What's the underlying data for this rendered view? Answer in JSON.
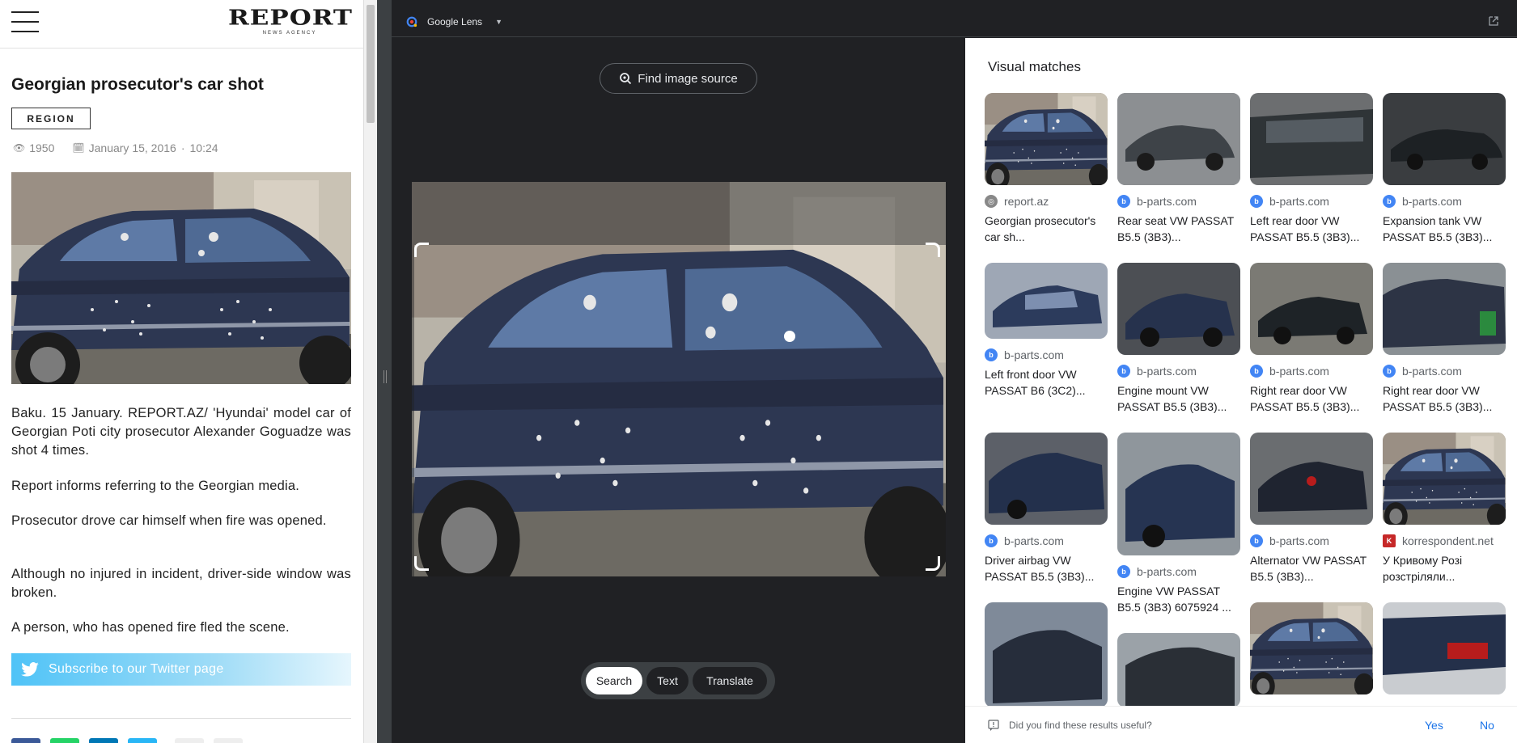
{
  "news": {
    "logo_main": "REPORT",
    "logo_sub": "NEWS AGENCY",
    "title": "Georgian prosecutor's car shot",
    "tag": "REGION",
    "views": "1950",
    "date": "January 15, 2016",
    "time": "10:24",
    "paragraphs": [
      "Baku. 15 January. REPORT.AZ/ 'Hyundai' model car of Georgian Poti city prosecutor Alexander Goguadze was shot 4 times.",
      "Report informs referring to the Georgian media.",
      "Prosecutor drove car himself when fire was opened.",
      "Although no injured in incident, driver-side window was broken.",
      "A person, who has opened fire fled the scene."
    ],
    "twitter_label": "Subscribe to our Twitter page"
  },
  "lens": {
    "title": "Google Lens",
    "find_source": "Find image source",
    "modes": [
      "Search",
      "Text",
      "Translate"
    ]
  },
  "results": {
    "title": "Visual matches",
    "items": [
      {
        "source": "report.az",
        "caption": "Georgian prosecutor's car sh..."
      },
      {
        "source": "b-parts.com",
        "caption": "Rear seat VW PASSAT B5.5 (3B3)..."
      },
      {
        "source": "b-parts.com",
        "caption": "Left rear door VW PASSAT B5.5 (3B3)..."
      },
      {
        "source": "b-parts.com",
        "caption": "Expansion tank VW PASSAT B5.5 (3B3)..."
      },
      {
        "source": "b-parts.com",
        "caption": "Left front door VW PASSAT B6 (3C2)..."
      },
      {
        "source": "b-parts.com",
        "caption": "Engine mount VW PASSAT B5.5 (3B3)..."
      },
      {
        "source": "b-parts.com",
        "caption": "Right rear door VW PASSAT B5.5 (3B3)..."
      },
      {
        "source": "b-parts.com",
        "caption": "Right rear door VW PASSAT B5.5 (3B3)..."
      },
      {
        "source": "b-parts.com",
        "caption": "Driver airbag VW PASSAT B5.5 (3B3)..."
      },
      {
        "source": "b-parts.com",
        "caption": "Engine VW PASSAT B5.5 (3B3) 6075924 ..."
      },
      {
        "source": "b-parts.com",
        "caption": "Alternator VW PASSAT B5.5 (3B3)..."
      },
      {
        "source": "korrespondent.net",
        "caption": "У Кривому Розі розстріляли..."
      }
    ],
    "feedback_question": "Did you find these results useful?",
    "yes": "Yes",
    "no": "No"
  },
  "colors": {
    "lens_bg": "#202124",
    "link_blue": "#1a73e8",
    "twitter": "#4fc3f7",
    "car_blue": "#2f3a55"
  }
}
